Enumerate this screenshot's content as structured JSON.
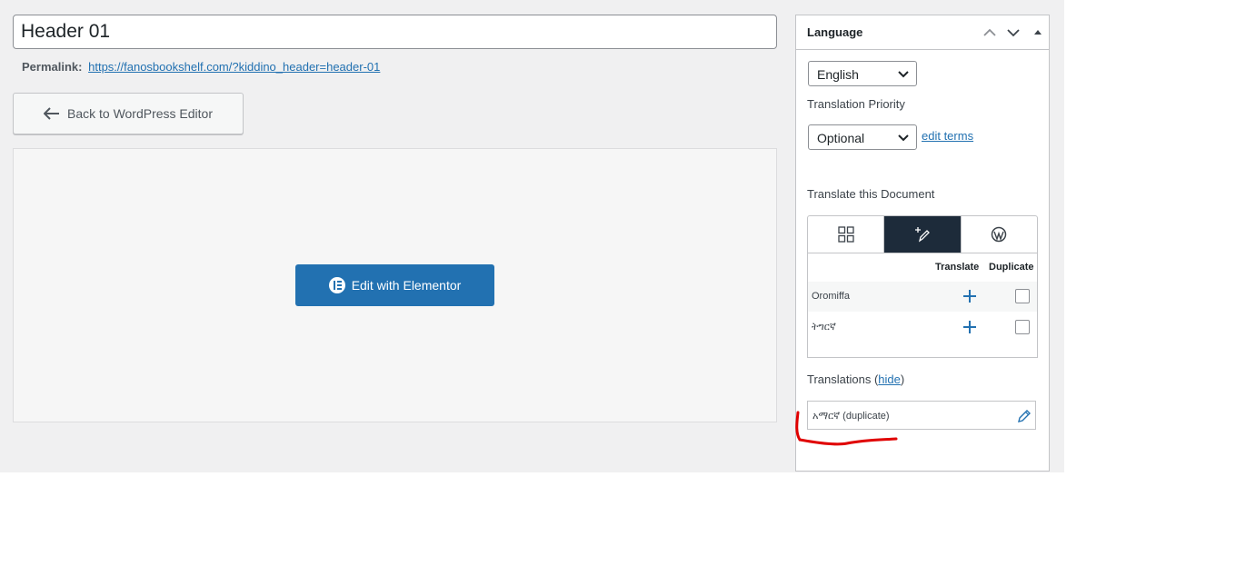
{
  "editor": {
    "title_value": "Header 01",
    "permalink_label": "Permalink:",
    "permalink_url": "https://fanosbookshelf.com/?kiddino_header=header-01",
    "back_button_label": "Back to WordPress Editor",
    "elementor_button_label": "Edit with Elementor"
  },
  "language_box": {
    "title": "Language",
    "language_select": "English",
    "priority_label": "Translation Priority",
    "priority_select": "Optional",
    "edit_terms_link": "edit terms",
    "translate_doc_label": "Translate this Document",
    "tabs": [
      {
        "icon": "grid-icon",
        "active": false
      },
      {
        "icon": "translate-pen-icon",
        "active": true
      },
      {
        "icon": "wordpress-icon",
        "active": false
      }
    ],
    "table_headers": {
      "translate": "Translate",
      "duplicate": "Duplicate"
    },
    "rows": [
      {
        "language": "Oromiffa"
      },
      {
        "language": "ትግርኛ"
      }
    ],
    "translations_label": "Translations",
    "hide_link": "hide",
    "translation_items": [
      {
        "text": "አማርኛ (duplicate)"
      }
    ]
  },
  "colors": {
    "accent": "#2271b1",
    "active_tab": "#1d2b3a",
    "annotation": "#e00000"
  }
}
